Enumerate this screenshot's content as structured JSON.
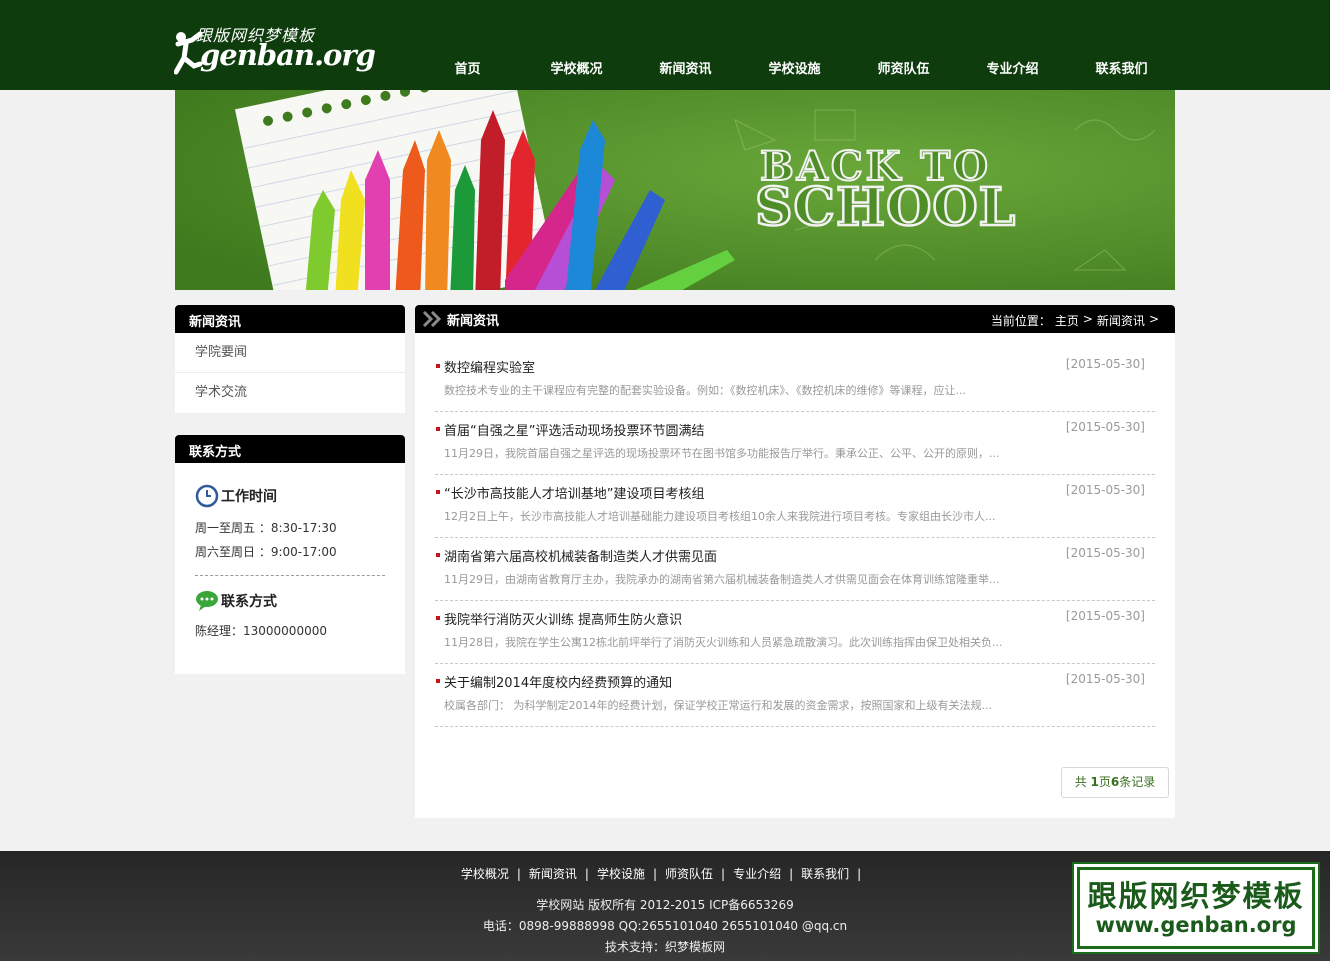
{
  "header": {
    "logo_cn": "跟版网织梦模板",
    "logo_en": "genban.org",
    "nav": [
      {
        "label": "首页"
      },
      {
        "label": "学校概况"
      },
      {
        "label": "新闻资讯"
      },
      {
        "label": "学校设施"
      },
      {
        "label": "师资队伍"
      },
      {
        "label": "专业介绍"
      },
      {
        "label": "联系我们"
      }
    ]
  },
  "banner": {
    "line1": "BACK TO",
    "line2": "SCHOOL",
    "colors": {
      "bg": "#4f8e27"
    }
  },
  "sidebar": {
    "news_title": "新闻资讯",
    "news_items": [
      {
        "label": "学院要闻"
      },
      {
        "label": "学术交流"
      }
    ],
    "contact_title": "联系方式",
    "work_time": {
      "title": "工作时间",
      "icon": "clock-icon",
      "lines": [
        "周一至周五 ：8:30-17:30",
        "周六至周日 ：9:00-17:00"
      ]
    },
    "contact": {
      "title": "联系方式",
      "icon": "chat-bubble-icon",
      "line": "陈经理：13000000000"
    }
  },
  "main": {
    "title": "新闻资讯",
    "breadcrumb": {
      "prefix": "当前位置：",
      "items": [
        "主页",
        "新闻资讯"
      ],
      "sep": ">"
    },
    "items": [
      {
        "title": "数控编程实验室",
        "date": "[2015-05-30]",
        "summary": "数控技术专业的主干课程应有完整的配套实验设备。例如：《数控机床》、《数控机床的维修》等课程，应让..."
      },
      {
        "title": "首届“自强之星”评选活动现场投票环节圆满结",
        "date": "[2015-05-30]",
        "summary": "11月29日，我院首届自强之星评选的现场投票环节在图书馆多功能报告厅举行。秉承公正、公平、公开的原则，..."
      },
      {
        "title": "“长沙市高技能人才培训基地”建设项目考核组",
        "date": "[2015-05-30]",
        "summary": "12月2日上午，长沙市高技能人才培训基础能力建设项目考核组10余人来我院进行项目考核。专家组由长沙市人..."
      },
      {
        "title": "湖南省第六届高校机械装备制造类人才供需见面",
        "date": "[2015-05-30]",
        "summary": "11月29日，由湖南省教育厅主办，我院承办的湖南省第六届机械装备制造类人才供需见面会在体育训练馆隆重举..."
      },
      {
        "title": "我院举行消防灭火训练 提高师生防火意识",
        "date": "[2015-05-30]",
        "summary": "11月28日，我院在学生公寓12栋北前坪举行了消防灭火训练和人员紧急疏散演习。此次训练指挥由保卫处相关负..."
      },
      {
        "title": "关于编制2014年度校内经费预算的通知",
        "date": "[2015-05-30]",
        "summary": "校属各部门： 为科学制定2014年的经费计划，保证学校正常运行和发展的资金需求，按照国家和上级有关法规..."
      }
    ],
    "pager": {
      "prefix": "共 ",
      "pages": "1",
      "mid": "页",
      "count": "6",
      "suffix": "条记录"
    }
  },
  "footer": {
    "links": [
      {
        "label": "学校概况"
      },
      {
        "label": "新闻资讯"
      },
      {
        "label": "学校设施"
      },
      {
        "label": "师资队伍"
      },
      {
        "label": "专业介绍"
      },
      {
        "label": "联系我们"
      }
    ],
    "sep": "|",
    "copyright": "学校网站 版权所有 2012-2015 ICP备6653269",
    "contact": "电话：0898-99888998 QQ:2655101040 2655101040 @qq.cn",
    "support": "技术支持：织梦模板网"
  },
  "watermark": {
    "line1": "跟版网织梦模板",
    "line2": "www.genban.org"
  }
}
